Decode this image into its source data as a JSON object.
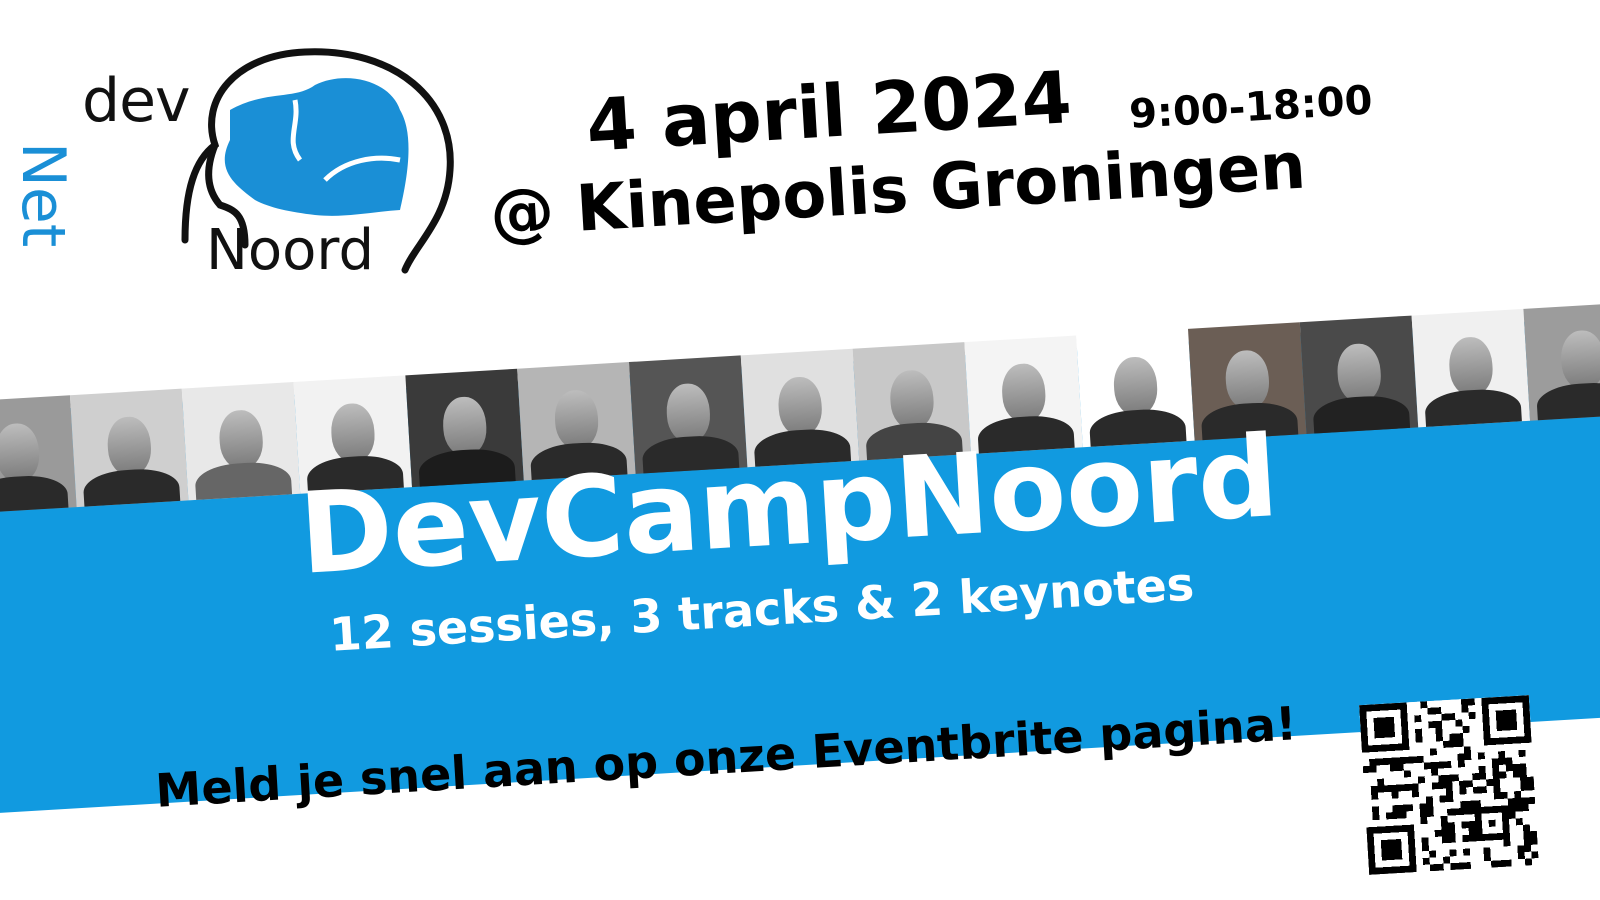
{
  "logo": {
    "dev": "dev",
    "net": "Net",
    "noord": "Noord",
    "colors": {
      "blue": "#1a8fd6",
      "black": "#111111"
    }
  },
  "event": {
    "date": "4 april 2024",
    "time": "9:00-18:00",
    "venue": "@ Kinepolis Groningen"
  },
  "banner": {
    "title": "DevCampNoord",
    "subtitle": "12 sessies, 3 tracks & 2 keynotes",
    "color": "#119ae0"
  },
  "speakers_count": 15,
  "cta": "Meld je snel aan op onze Eventbrite pagina!",
  "qr": {
    "icon": "qr-code"
  }
}
